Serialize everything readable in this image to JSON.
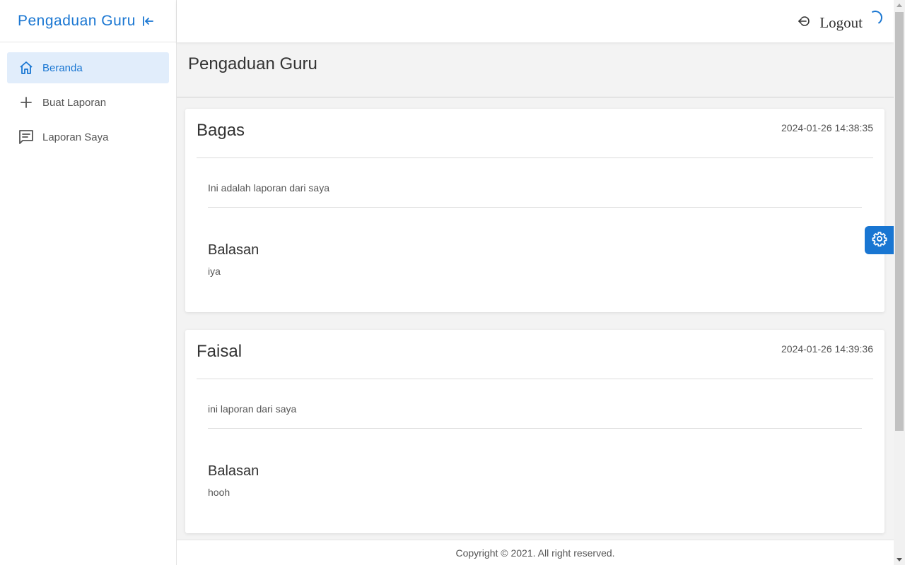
{
  "app": {
    "title": "Pengaduan Guru"
  },
  "sidebar": {
    "items": [
      {
        "label": "Beranda",
        "icon": "home-icon",
        "active": true
      },
      {
        "label": "Buat Laporan",
        "icon": "plus-icon",
        "active": false
      },
      {
        "label": "Laporan Saya",
        "icon": "message-icon",
        "active": false
      }
    ]
  },
  "topbar": {
    "logout_label": "Logout"
  },
  "page": {
    "title": "Pengaduan Guru"
  },
  "reports": [
    {
      "name": "Bagas",
      "timestamp": "2024-01-26 14:38:35",
      "text": "Ini adalah laporan dari saya",
      "reply_title": "Balasan",
      "reply_text": "iya"
    },
    {
      "name": "Faisal",
      "timestamp": "2024-01-26 14:39:36",
      "text": "ini laporan dari saya",
      "reply_title": "Balasan",
      "reply_text": "hooh"
    }
  ],
  "footer": {
    "text": "Copyright © 2021. All right reserved."
  },
  "colors": {
    "accent": "#1976d2",
    "active_bg": "#e1edfb"
  }
}
